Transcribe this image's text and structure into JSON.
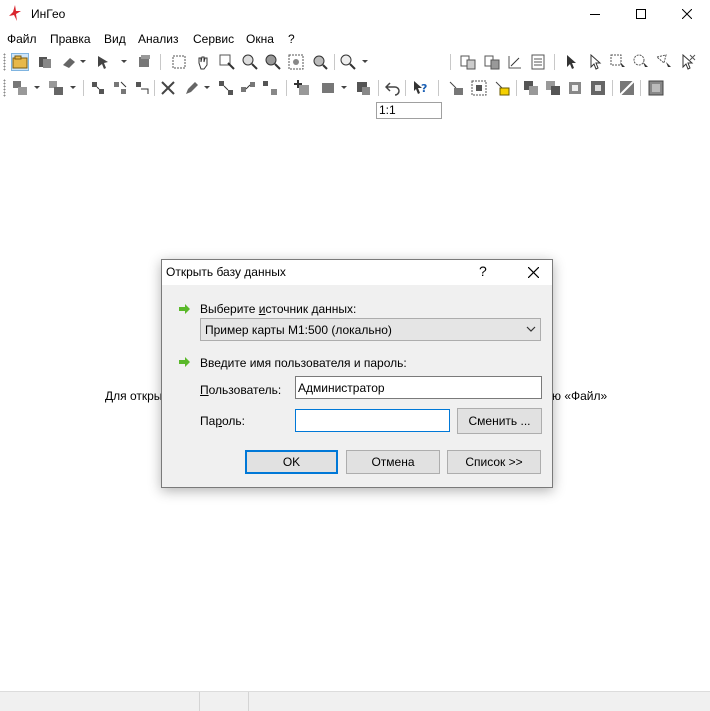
{
  "app": {
    "title": "ИнГео"
  },
  "menu": [
    "Файл",
    "Правка",
    "Вид",
    "Анализ",
    "Сервис",
    "Окна",
    "?"
  ],
  "toolbar": {
    "scale_value": "1:1"
  },
  "background": {
    "hint_left": "Для откры",
    "hint_right": "ю «Файл»"
  },
  "dialog": {
    "title": "Открыть базу данных",
    "help": "?",
    "source_label_pre": "Выберите ",
    "source_label_u": "и",
    "source_label_post": "сточник данных:",
    "source_value": "Пример карты М1:500 (локально)",
    "creds_label": "Введите имя пользователя и пароль:",
    "user_label_u": "П",
    "user_label_post": "ользователь:",
    "user_value": "Администратор",
    "password_label_pre": "Па",
    "password_label_u": "р",
    "password_label_post": "оль:",
    "password_value": "",
    "change_button": "Сменить ...",
    "ok_button": "OK",
    "cancel_button": "Отмена",
    "list_button": "Список >>"
  },
  "colors": {
    "accent": "#0078d7",
    "arrow": "#5ab82a",
    "app_icon": "#d9262e"
  }
}
